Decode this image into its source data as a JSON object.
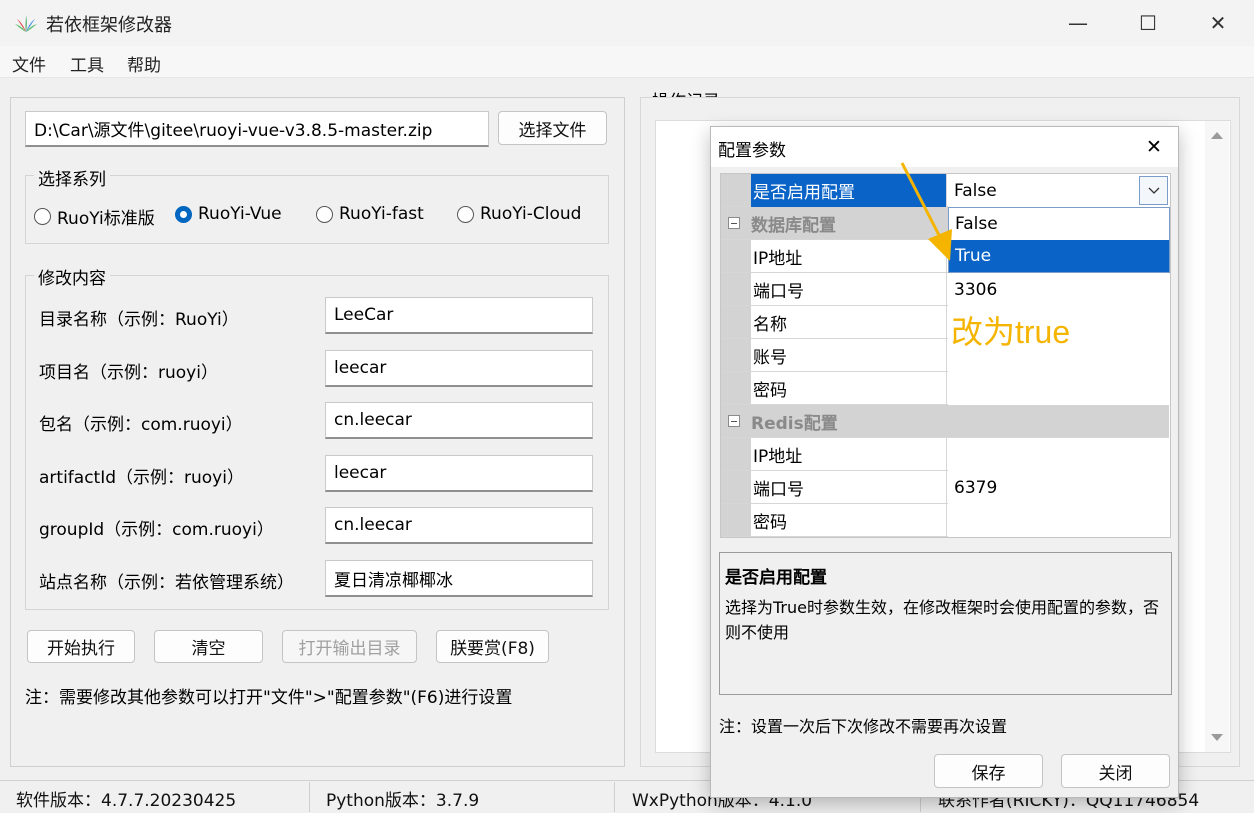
{
  "window": {
    "title": "若依框架修改器",
    "minimize_glyph": "—",
    "maximize_glyph": "☐",
    "close_glyph": "✕"
  },
  "menu": [
    "文件",
    "工具",
    "帮助"
  ],
  "file_path": "D:\\Car\\源文件\\gitee\\ruoyi-vue-v3.8.5-master.zip",
  "choose_file_label": "选择文件",
  "series": {
    "label": "选择系列",
    "options": [
      "RuoYi标准版",
      "RuoYi-Vue",
      "RuoYi-fast",
      "RuoYi-Cloud"
    ],
    "selected": "RuoYi-Vue"
  },
  "modify": {
    "label": "修改内容",
    "fields": [
      {
        "label": "目录名称（示例：RuoYi）",
        "value": "LeeCar"
      },
      {
        "label": "项目名（示例：ruoyi）",
        "value": "leecar"
      },
      {
        "label": "包名（示例：com.ruoyi）",
        "value": "cn.leecar"
      },
      {
        "label": "artifactId（示例：ruoyi）",
        "value": "leecar"
      },
      {
        "label": "groupId（示例：com.ruoyi）",
        "value": "cn.leecar"
      },
      {
        "label": "站点名称（示例：若依管理系统）",
        "value": "夏日清凉椰椰冰"
      }
    ]
  },
  "buttons": {
    "start": "开始执行",
    "clear": "清空",
    "open_output": "打开输出目录",
    "reward": "朕要赏(F8)"
  },
  "note_main": "注：需要修改其他参数可以打开\"文件\">\"配置参数\"(F6)进行设置",
  "log_label": "操作记录",
  "status": {
    "software": "软件版本：4.7.7.20230425",
    "python": "Python版本：3.7.9",
    "wx": "WxPython版本：4.1.0",
    "contact": "联系作者(RICKY)：QQ11746854"
  },
  "dialog": {
    "title": "配置参数",
    "close_glyph": "✕",
    "enable_row": {
      "name": "是否启用配置",
      "value": "False"
    },
    "dropdown_options": [
      "False",
      "True"
    ],
    "dropdown_highlighted": "True",
    "db_category": "数据库配置",
    "db_rows": [
      {
        "name": "IP地址",
        "value": ""
      },
      {
        "name": "端口号",
        "value": "3306"
      },
      {
        "name": "名称",
        "value": ""
      },
      {
        "name": "账号",
        "value": ""
      },
      {
        "name": "密码",
        "value": ""
      }
    ],
    "redis_category": "Redis配置",
    "redis_rows": [
      {
        "name": "IP地址",
        "value": ""
      },
      {
        "name": "端口号",
        "value": "6379"
      },
      {
        "name": "密码",
        "value": ""
      }
    ],
    "help_title": "是否启用配置",
    "help_text": "选择为True时参数生效，在修改框架时会使用配置的参数，否则不使用",
    "note": "注：设置一次后下次修改不需要再次设置",
    "save_label": "保存",
    "close_label": "关闭"
  },
  "annotation": {
    "text": "改为true",
    "color": "#f5b400"
  },
  "colors": {
    "accent": "#0067c0",
    "selection": "#0a64c8"
  }
}
